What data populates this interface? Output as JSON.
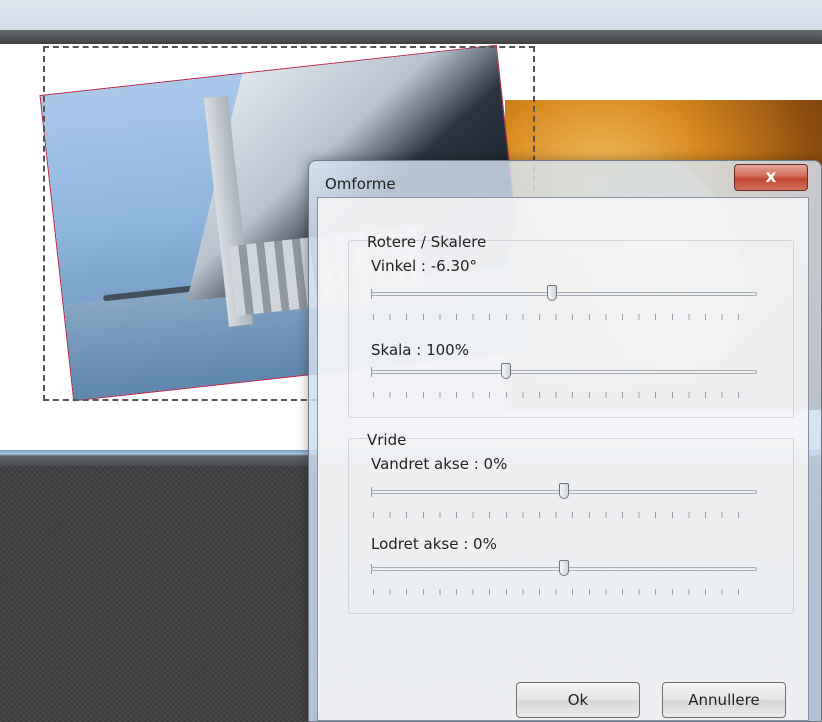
{
  "dialog": {
    "title": "Omforme",
    "close_glyph": "x",
    "rotate_scale": {
      "title": "Rotere / Skalere",
      "angle": {
        "label": "Vinkel : -6.30°",
        "value_degrees": -6.3,
        "position_fraction": 0.47
      },
      "scale": {
        "label": "Skala : 100%",
        "value_percent": 100,
        "position_fraction": 0.35
      }
    },
    "skew": {
      "title": "Vride",
      "horizontal": {
        "label": "Vandret akse : 0%",
        "value_percent": 0,
        "position_fraction": 0.5
      },
      "vertical": {
        "label": "Lodret akse : 0%",
        "value_percent": 0,
        "position_fraction": 0.5
      }
    },
    "buttons": {
      "ok": "Ok",
      "cancel": "Annullere"
    }
  },
  "icons": {
    "close": "close-icon"
  },
  "colors": {
    "close_button": "#c8503a",
    "dialog_glass": "#cddcee"
  }
}
